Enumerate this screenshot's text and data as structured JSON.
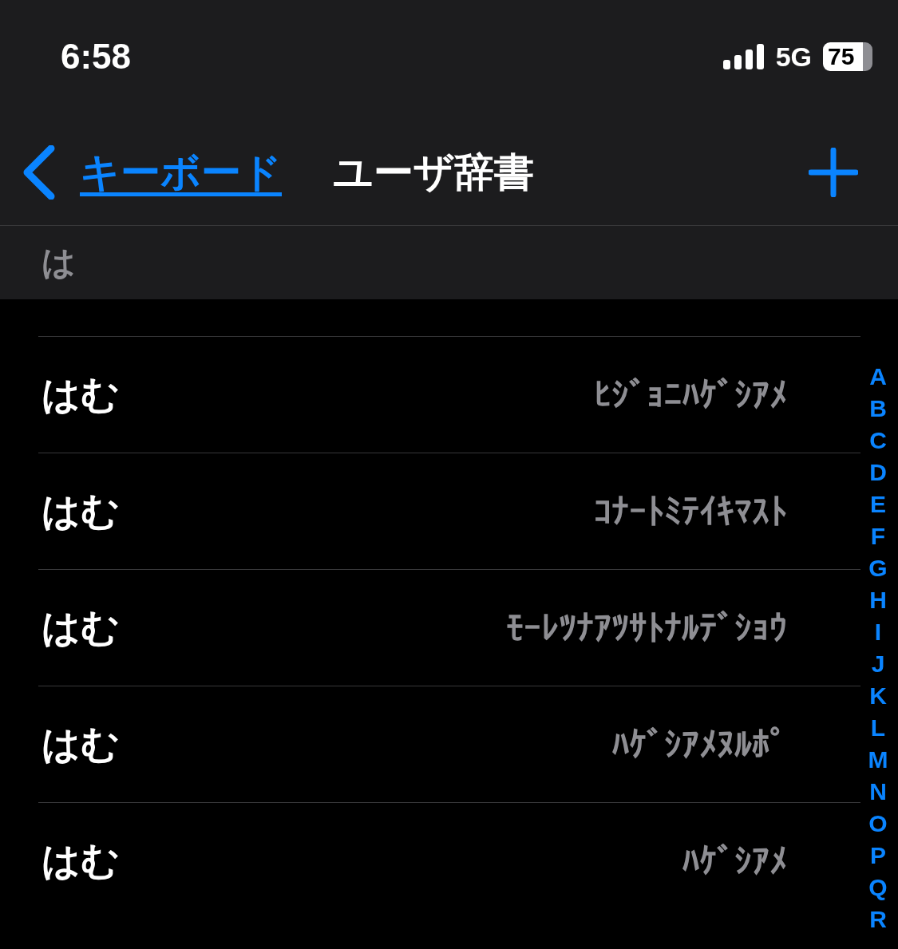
{
  "status_bar": {
    "time": "6:58",
    "network": "5G",
    "battery": "75"
  },
  "nav": {
    "back_label": "キーボード",
    "title": "ユーザ辞書"
  },
  "section": {
    "header": "は"
  },
  "entries": [
    {
      "reading": "はむ",
      "phrase": "ﾋｼﾞｮﾆﾊｹﾞｼｱﾒ"
    },
    {
      "reading": "はむ",
      "phrase": "ｺﾅｰﾄﾐﾃｲｷﾏｽﾄ"
    },
    {
      "reading": "はむ",
      "phrase": "ﾓｰﾚﾂﾅｱﾂｻﾄﾅﾙﾃﾞｼｮｳ"
    },
    {
      "reading": "はむ",
      "phrase": "ﾊｹﾞｼｱﾒﾇﾙﾎﾟ"
    },
    {
      "reading": "はむ",
      "phrase": "ﾊｹﾞｼｱﾒ"
    }
  ],
  "index": [
    "A",
    "B",
    "C",
    "D",
    "E",
    "F",
    "G",
    "H",
    "I",
    "J",
    "K",
    "L",
    "M",
    "N",
    "O",
    "P",
    "Q",
    "R"
  ]
}
